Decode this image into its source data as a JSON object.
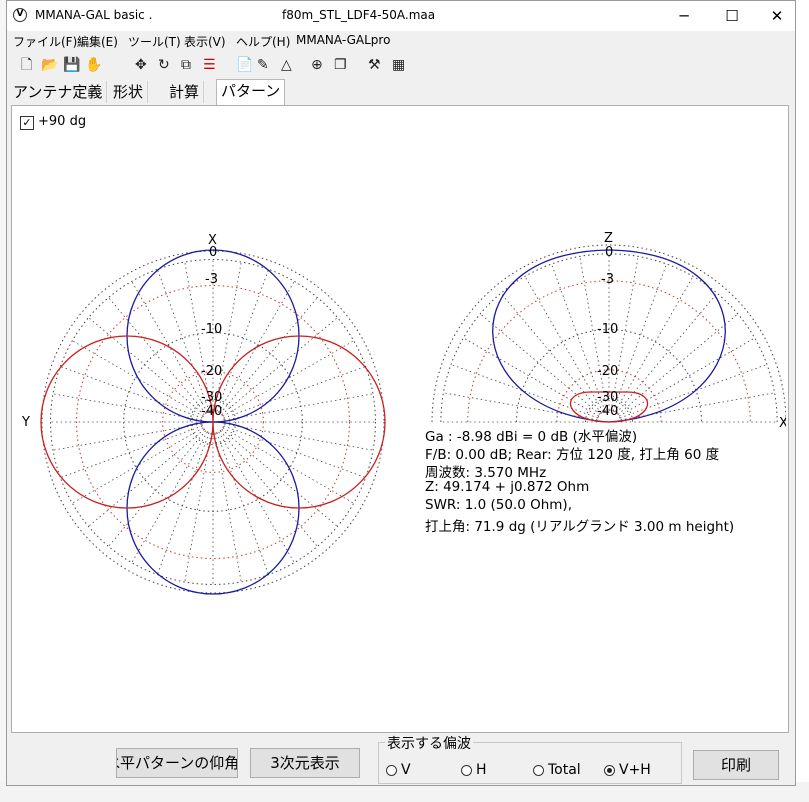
{
  "window": {
    "app_title": "MMANA-GAL basic .",
    "file_name": "f80m_STL_LDF4-50A.maa",
    "minimize": "─",
    "maximize": "☐",
    "close": "✕"
  },
  "menu": [
    "ファイル(F)",
    "編集(E)",
    "ツール(T)",
    "表示(V)",
    "ヘルプ(H)",
    "MMANA-GALpro"
  ],
  "tabs": [
    "アンテナ定義",
    "形状",
    "計算",
    "パターン"
  ],
  "pattern": {
    "checkbox_label": "+90 dg",
    "checkbox_checked": true,
    "horizontal_plot": {
      "axis_top": "X",
      "axis_left": "Y",
      "ring_labels": [
        "0",
        "-3",
        "-10",
        "-20",
        "-30",
        "-40"
      ]
    },
    "vertical_plot": {
      "axis_top": "Z",
      "axis_right": "X",
      "ring_labels": [
        "0",
        "-3",
        "-10",
        "-20",
        "-30",
        "-40"
      ]
    },
    "info": {
      "ga": "Ga : -8.98 dBi = 0 dB (水平偏波)",
      "fb": "F/B: 0.00 dB; Rear: 方位 120 度,  打上角 60 度",
      "freq": "周波数: 3.570 MHz",
      "z": "Z: 49.174 + j0.872 Ohm",
      "swr": "SWR: 1.0 (50.0 Ohm),",
      "elev": "打上角: 71.9 dg (リアルグランド  3.00 m height)"
    }
  },
  "buttons": {
    "elev_pattern": "水平パターンの仰角",
    "view3d": "3次元表示",
    "print": "印刷"
  },
  "polarization": {
    "title": "表示する偏波",
    "options": [
      "V",
      "H",
      "Total",
      "V+H"
    ],
    "selected": "V+H"
  },
  "colors": {
    "vertical_pattern": "#1a1aa0",
    "horizontal_pattern": "#cc1f1f",
    "grid_dotted": "#444444",
    "grid_red": "#d03030"
  }
}
